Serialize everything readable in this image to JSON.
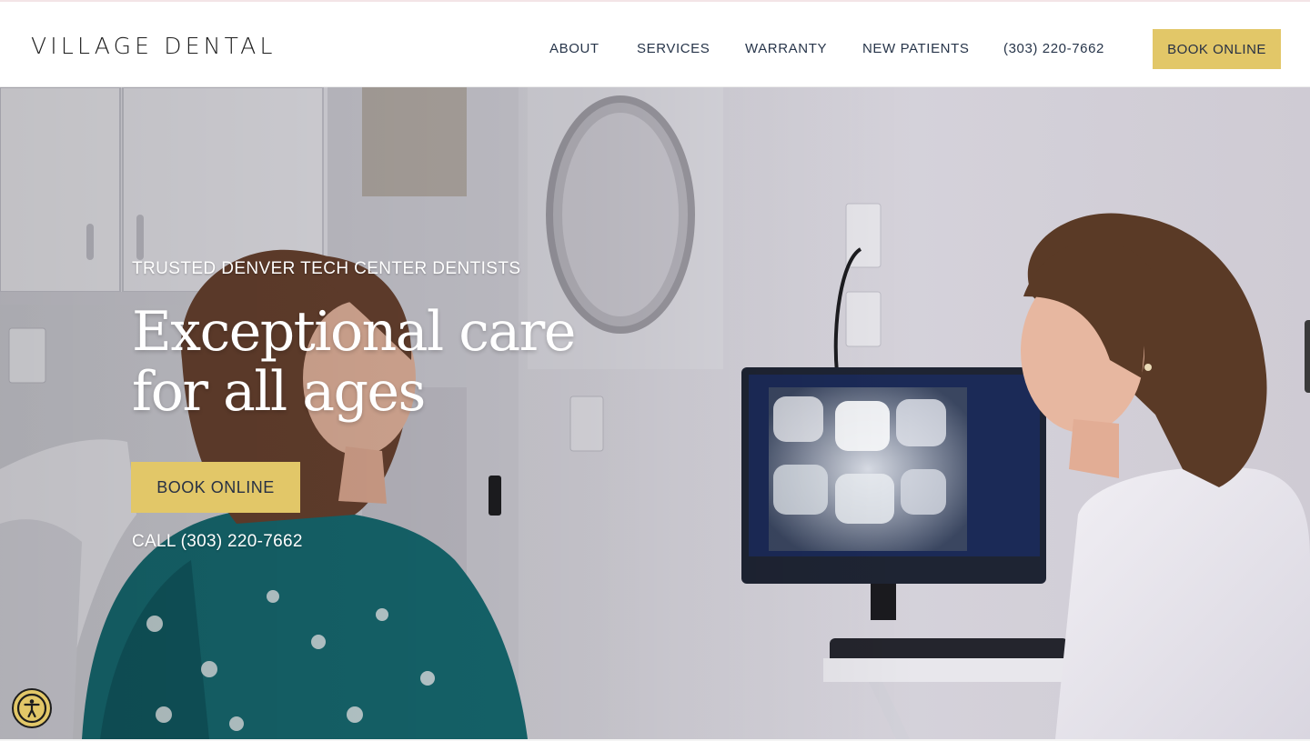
{
  "brand": {
    "logo_text": "VILLAGE DENTAL"
  },
  "nav": {
    "items": [
      {
        "label": "ABOUT"
      },
      {
        "label": "SERVICES"
      },
      {
        "label": "WARRANTY"
      },
      {
        "label": "NEW PATIENTS"
      }
    ],
    "phone": "(303) 220-7662",
    "book_label": "BOOK ONLINE"
  },
  "hero": {
    "eyebrow": "TRUSTED DENVER TECH CENTER DENTISTS",
    "headline_line1": "Exceptional care",
    "headline_line2": "for all ages",
    "book_label": "BOOK ONLINE",
    "call_label": "CALL (303) 220-7662"
  },
  "icons": {
    "accessibility": "accessibility-icon",
    "side_tab": "side-tab-handle"
  },
  "colors": {
    "accent": "#e2c768",
    "nav_text": "#27354a",
    "logo": "#1d1d1d",
    "hero_text": "#ffffff"
  }
}
